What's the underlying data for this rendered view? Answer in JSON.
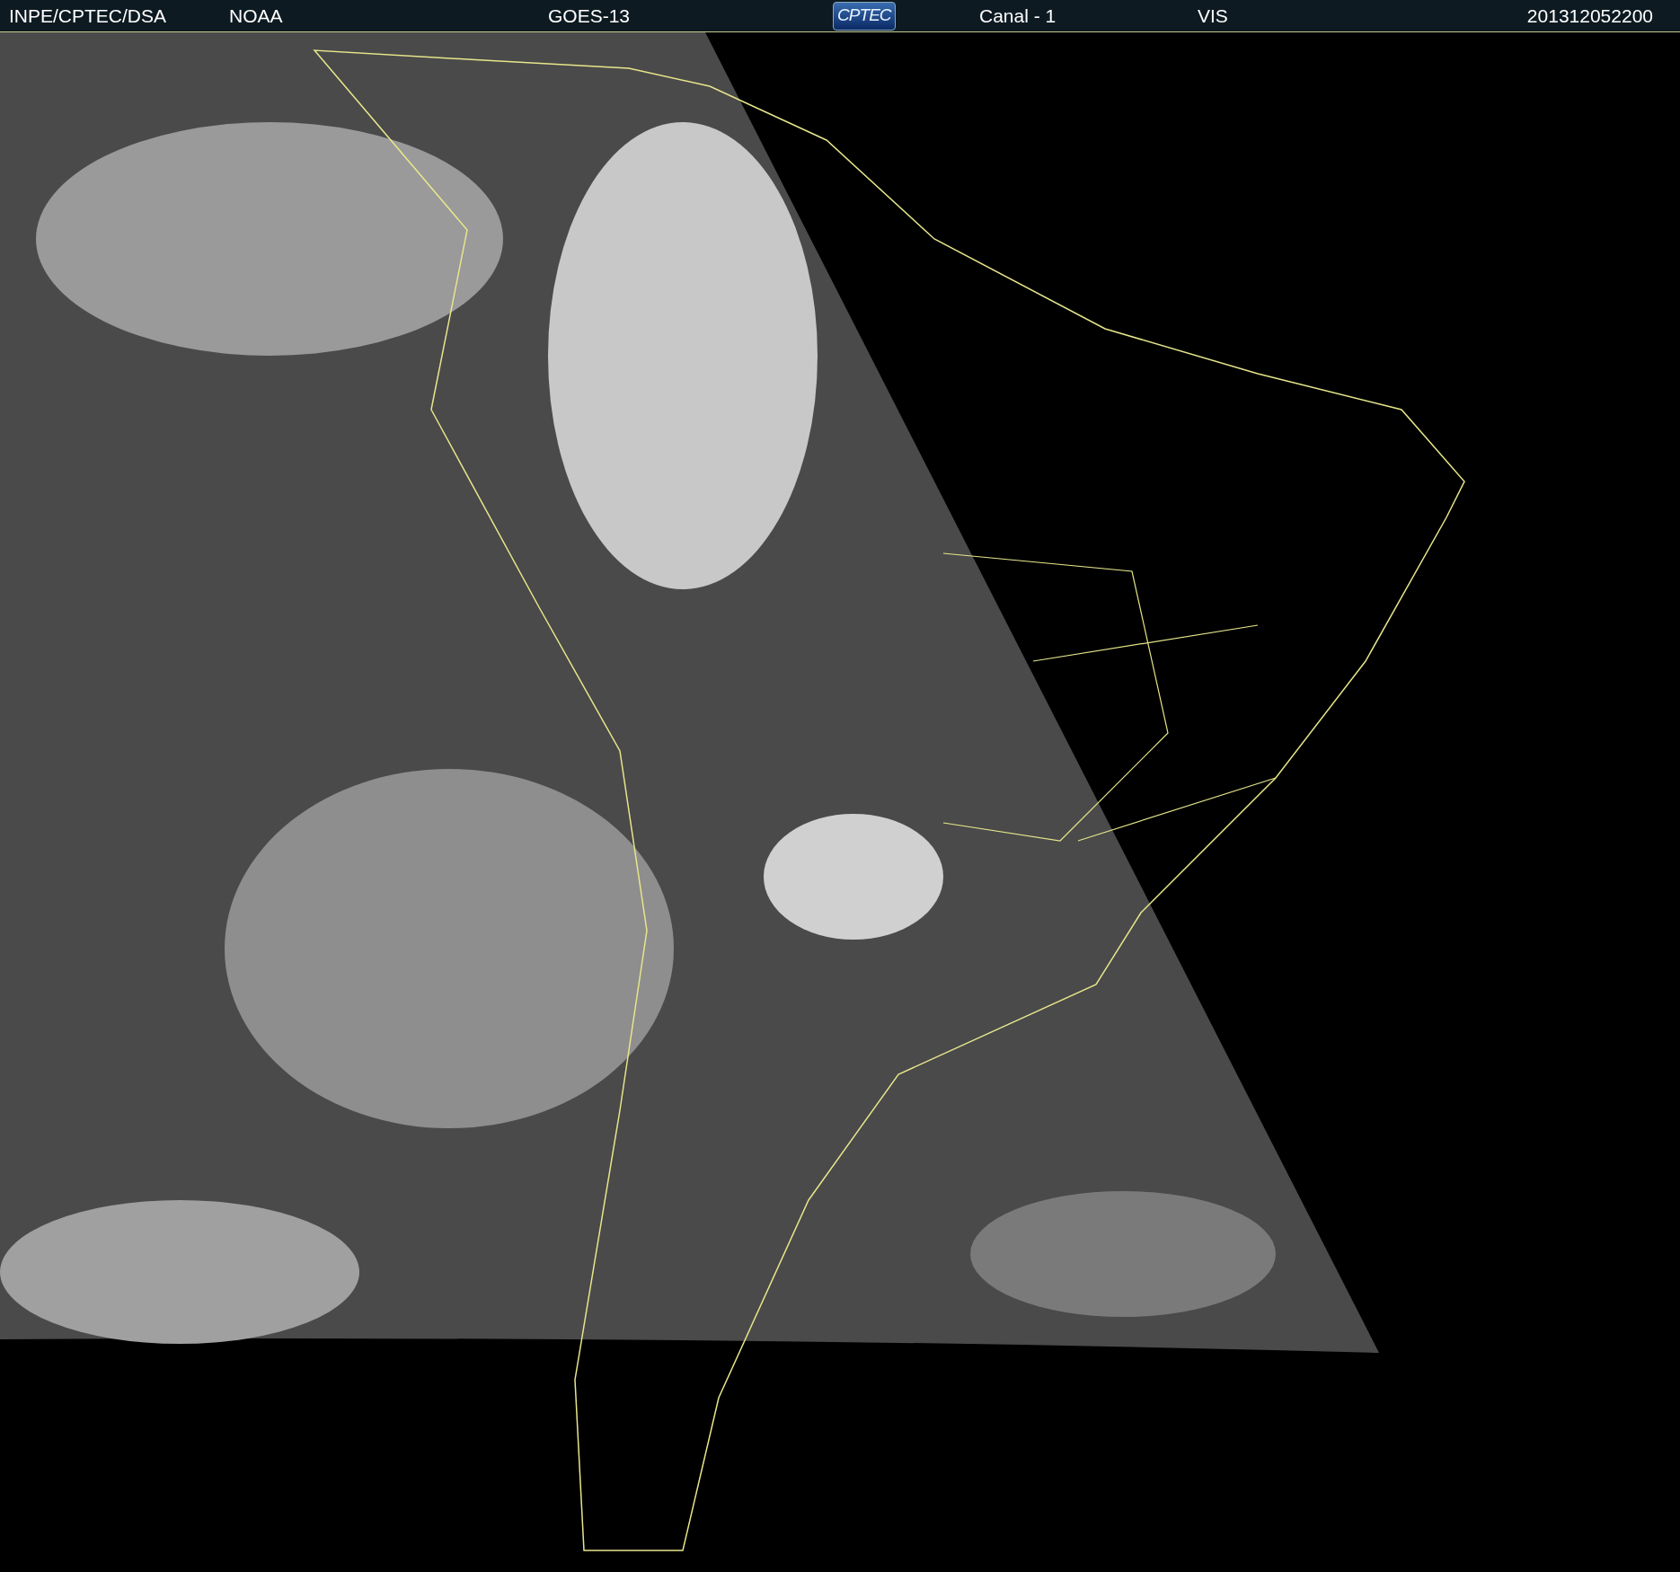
{
  "header": {
    "items": [
      {
        "kind": "text",
        "text": "INPE/CPTEC/DSA"
      },
      {
        "kind": "text",
        "text": "NOAA"
      },
      {
        "kind": "text",
        "text": "GOES-13"
      },
      {
        "kind": "logo",
        "text": "CPTEC"
      },
      {
        "kind": "text",
        "text": "Canal - 1"
      },
      {
        "kind": "text",
        "text": "VIS"
      },
      {
        "kind": "text",
        "text": "201312052200"
      }
    ]
  }
}
